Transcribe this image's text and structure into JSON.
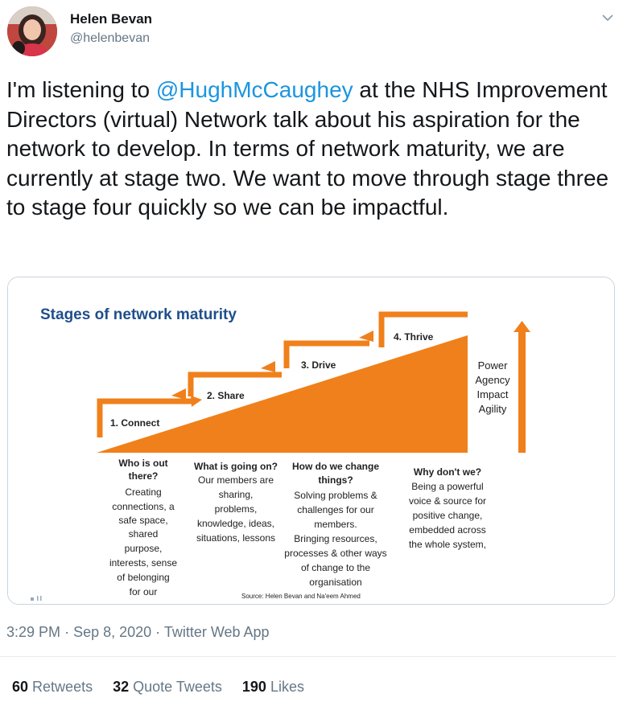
{
  "author": {
    "name": "Helen Bevan",
    "handle": "@helenbevan"
  },
  "icons": {
    "avatar": "avatar-photo",
    "menu": "chevron-down-icon"
  },
  "tweet": {
    "before": "I'm listening to ",
    "mention": "@HughMcCaughey",
    "after": " at the NHS Improvement Directors (virtual) Network talk about his aspiration for the network to develop. In terms of network maturity, we are currently at stage two. We want to move through stage three to stage four quickly so we can be impactful."
  },
  "image": {
    "title": "Stages of network maturity",
    "stages": [
      "1. Connect",
      "2. Share",
      "3. Drive",
      "4. Thrive"
    ],
    "side_labels": [
      "Power",
      "Agency",
      "Impact",
      "Agility"
    ],
    "columns": [
      {
        "heading": [
          "Who is out",
          "there?"
        ],
        "body": [
          "Creating",
          "connections, a",
          "safe space,",
          "shared",
          "purpose,",
          "interests, sense",
          "of belonging",
          "for our"
        ]
      },
      {
        "heading": [
          "What is going on?"
        ],
        "body": [
          "Our members are",
          "sharing,",
          "problems,",
          "knowledge, ideas,",
          "situations, lessons"
        ]
      },
      {
        "heading": [
          "How do we change",
          "things?"
        ],
        "body": [
          "Solving problems &",
          "challenges for our",
          "members.",
          "Bringing resources,",
          "processes & other ways",
          "of change to the",
          "organisation"
        ]
      },
      {
        "heading": [
          "Why don't we?"
        ],
        "body": [
          "Being a powerful",
          "voice & source for",
          "positive change,",
          "embedded across",
          "the whole system,"
        ]
      }
    ],
    "source": "Source: Helen Bevan and Na'eem Ahmed",
    "colors": {
      "orange": "#f0801b",
      "title": "#1f4e8c"
    }
  },
  "meta": {
    "time": "3:29 PM",
    "date": "Sep 8, 2020",
    "app": "Twitter Web App"
  },
  "stats": [
    {
      "count": "60",
      "label": "Retweets"
    },
    {
      "count": "32",
      "label": "Quote Tweets"
    },
    {
      "count": "190",
      "label": "Likes"
    }
  ]
}
